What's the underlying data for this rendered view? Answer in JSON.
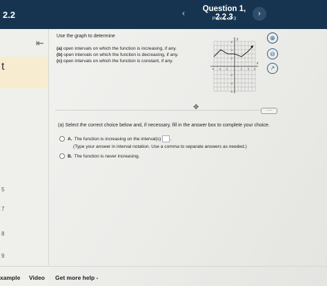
{
  "header": {
    "section": "2.2",
    "question_title": "Question 1, 2.2.3",
    "part": "Part 1 of 3",
    "prev_icon": "chevron-left-icon",
    "next_icon": "chevron-right-icon"
  },
  "sidebar": {
    "partial_label": "t",
    "numbers": [
      "5",
      "7",
      "8",
      "9"
    ]
  },
  "question": {
    "prompt": "Use the graph to determine",
    "parts": [
      {
        "letter": "(a)",
        "text": "open intervals on which the function is increasing, if any."
      },
      {
        "letter": "(b)",
        "text": "open intervals on which the function is decreasing, if any."
      },
      {
        "letter": "(c)",
        "text": "open intervals on which the function is constant, if any."
      }
    ]
  },
  "graph": {
    "y_label": "y",
    "x_label": "x",
    "x_ticks": [
      "-6",
      "-4",
      "-2",
      "2",
      "4",
      "6"
    ],
    "y_ticks": [
      "6",
      "4",
      "2",
      "-2",
      "-4",
      "-6"
    ]
  },
  "tools": {
    "zoom_in_icon": "zoom-in-icon",
    "zoom_out_icon": "zoom-out-icon",
    "popout_icon": "external-link-icon"
  },
  "answer": {
    "instruction": "(a) Select the correct choice below and, if necessary, fill in the answer box to complete your choice.",
    "choice_a_letter": "A.",
    "choice_a_text": "The function is increasing on the interval(s)",
    "choice_a_hint": "(Type your answer in interval notation. Use a comma to separate answers as needed.)",
    "choice_b_letter": "B.",
    "choice_b_text": "The function is never increasing.",
    "more_label": "....."
  },
  "footer": {
    "example": "xample",
    "video": "Video",
    "help": "Get more help -"
  },
  "colors": {
    "header_bg": "#16344f",
    "accent": "#1a4f7a"
  }
}
